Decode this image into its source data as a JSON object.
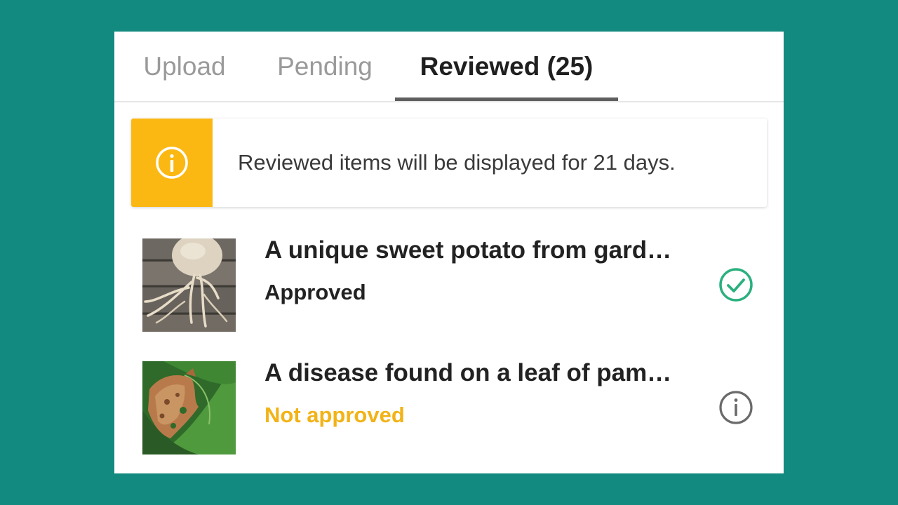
{
  "tabs": [
    {
      "label": "Upload",
      "active": false
    },
    {
      "label": "Pending",
      "active": false
    },
    {
      "label": "Reviewed (25)",
      "active": true
    }
  ],
  "notice": {
    "icon": "info-icon",
    "text": "Reviewed items will be displayed for 21 days.",
    "accent_color": "#fbb812"
  },
  "items": [
    {
      "title": "A unique sweet potato from gard…",
      "status": "Approved",
      "status_icon": "check-circle-icon",
      "status_color": "#222222",
      "icon_color": "#2bb07f",
      "thumbnail": "sweet-potato-photo"
    },
    {
      "title": "A disease found on a leaf of pam…",
      "status": "Not approved",
      "status_icon": "info-circle-icon",
      "status_color": "#f2b318",
      "icon_color": "#6a6a6a",
      "thumbnail": "diseased-leaf-photo"
    }
  ],
  "colors": {
    "background": "#138a80",
    "panel": "#ffffff",
    "active_tab_indicator": "#5f5f5f"
  }
}
